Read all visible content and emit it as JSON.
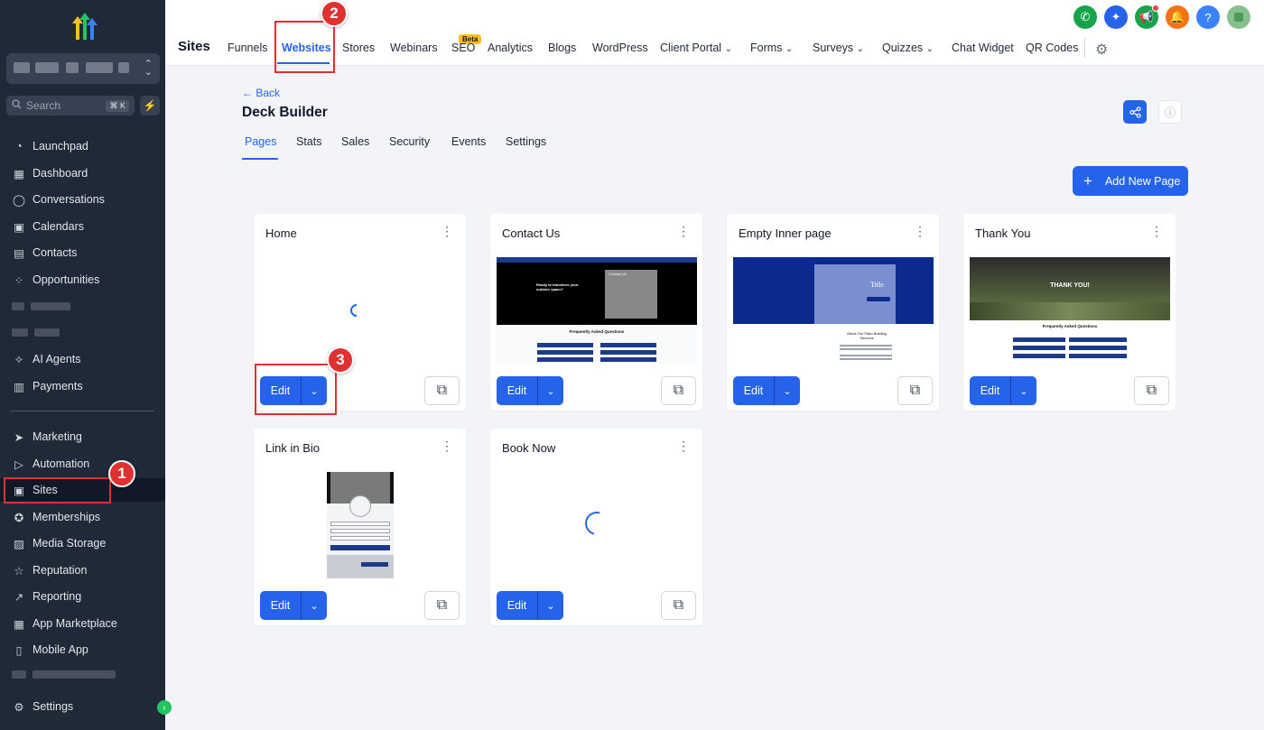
{
  "sidebar": {
    "search_placeholder": "Search",
    "search_shortcut": "⌘ K",
    "items": [
      {
        "label": "Launchpad",
        "icon": "rocket-icon"
      },
      {
        "label": "Dashboard",
        "icon": "grid-icon"
      },
      {
        "label": "Conversations",
        "icon": "chat-icon"
      },
      {
        "label": "Calendars",
        "icon": "calendar-icon"
      },
      {
        "label": "Contacts",
        "icon": "contacts-icon"
      },
      {
        "label": "Opportunities",
        "icon": "opportunities-icon"
      },
      {
        "label": "AI Agents",
        "icon": "sparkle-icon"
      },
      {
        "label": "Payments",
        "icon": "receipt-icon"
      },
      {
        "label": "Marketing",
        "icon": "send-icon"
      },
      {
        "label": "Automation",
        "icon": "play-icon"
      },
      {
        "label": "Sites",
        "icon": "sites-icon"
      },
      {
        "label": "Memberships",
        "icon": "award-icon"
      },
      {
        "label": "Media Storage",
        "icon": "image-icon"
      },
      {
        "label": "Reputation",
        "icon": "star-icon"
      },
      {
        "label": "Reporting",
        "icon": "trend-icon"
      },
      {
        "label": "App Marketplace",
        "icon": "apps-icon"
      },
      {
        "label": "Mobile App",
        "icon": "phone-icon"
      },
      {
        "label": "Settings",
        "icon": "gear-icon"
      }
    ]
  },
  "topbar": {
    "title": "Sites",
    "tabs": [
      "Funnels",
      "Websites",
      "Stores",
      "Webinars",
      "SEO",
      "Analytics",
      "Blogs",
      "WordPress",
      "Client Portal",
      "Forms",
      "Surveys",
      "Quizzes",
      "Chat Widget",
      "QR Codes"
    ],
    "beta_label": "Beta",
    "colors": {
      "phone": "#16a34a",
      "sparkle": "#2563eb",
      "announce": "#16a34a",
      "bell": "#f97316",
      "help": "#3b82f6"
    }
  },
  "annotations": [
    "1",
    "2",
    "3"
  ],
  "main": {
    "back_label": "Back",
    "title": "Deck Builder",
    "subtabs": [
      "Pages",
      "Stats",
      "Sales",
      "Security",
      "Events",
      "Settings"
    ],
    "add_button": "Add New Page",
    "edit_label": "Edit",
    "cards": [
      {
        "title": "Home"
      },
      {
        "title": "Contact Us"
      },
      {
        "title": "Empty Inner page"
      },
      {
        "title": "Thank You"
      },
      {
        "title": "Link in Bio"
      },
      {
        "title": "Book Now"
      }
    ],
    "thumb_text": {
      "contact_hero": "Ready to transform your outdoor space?",
      "contact_form": "Contact Us",
      "faq": "Frequently Asked Questions",
      "empty_title": "Title",
      "empty_about": "About Our Patio Building Services",
      "thanks": "THANK YOU!"
    }
  },
  "accent": "#2563eb"
}
